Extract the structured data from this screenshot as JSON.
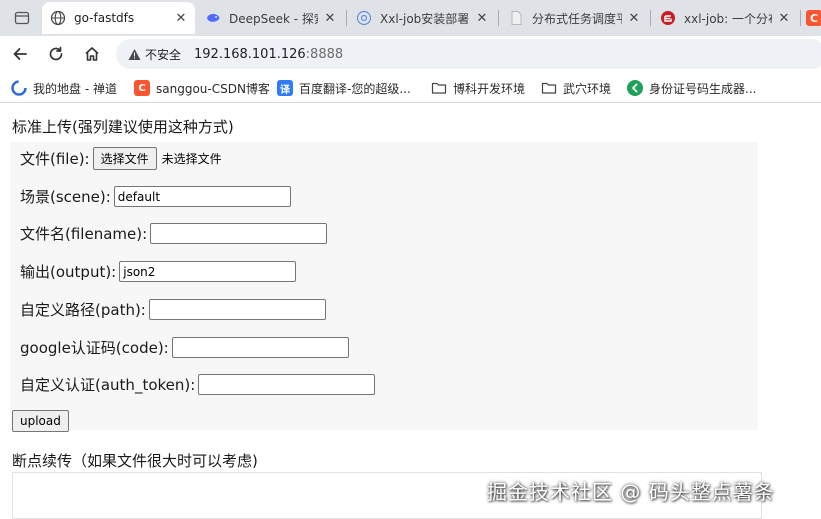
{
  "browser": {
    "tabs": [
      {
        "title": "go-fastdfs",
        "icon": "globe-icon",
        "active": true
      },
      {
        "title": "DeepSeek - 探索",
        "icon": "deepseek-whale-icon",
        "active": false
      },
      {
        "title": "Xxl-job安装部署",
        "icon": "xxl-job-icon",
        "active": false
      },
      {
        "title": "分布式任务调度平",
        "icon": "blank-page-icon",
        "active": false
      },
      {
        "title": "xxl-job: 一个分布",
        "icon": "gitee-icon",
        "active": false
      },
      {
        "title": "C",
        "icon": "csdn-icon",
        "active": false
      }
    ],
    "toolbar": {
      "security_label": "不安全",
      "url_host": "192.168.101.126",
      "url_port": ":8888"
    },
    "bookmarks": [
      {
        "label": "我的地盘 - 禅道",
        "icon": "zentao-icon"
      },
      {
        "label": "sanggou-CSDN博客",
        "icon": "csdn-icon"
      },
      {
        "label": "百度翻译-您的超级...",
        "icon": "baidu-translate-icon"
      },
      {
        "label": "博科开发环境",
        "icon": "folder-icon"
      },
      {
        "label": "武穴环境",
        "icon": "folder-icon"
      },
      {
        "label": "身份证号码生成器...",
        "icon": "green-check-icon"
      }
    ]
  },
  "page": {
    "standard_title": "标准上传(强列建议使用这种方式)",
    "fields": {
      "file_label": "文件(file):",
      "file_button": "选择文件",
      "file_status": "未选择文件",
      "scene_label": "场景(scene):",
      "scene_value": "default",
      "filename_label": "文件名(filename):",
      "filename_value": "",
      "output_label": "输出(output):",
      "output_value": "json2",
      "path_label": "自定义路径(path):",
      "path_value": "",
      "code_label": "google认证码(code):",
      "code_value": "",
      "auth_label": "自定义认证(auth_token):",
      "auth_value": ""
    },
    "upload_button": "upload",
    "resume_title": "断点续传（如果文件很大时可以考虑)"
  },
  "watermark": "掘金技术社区 @ 码头整点薯条",
  "colors": {
    "tab_strip": "#dfe3e8",
    "omnibox": "#eef1f5",
    "form_panel": "#f7f7f7",
    "csdn_red": "#fc5531",
    "baidu_blue": "#2e7cf6",
    "green": "#1fa15a"
  }
}
